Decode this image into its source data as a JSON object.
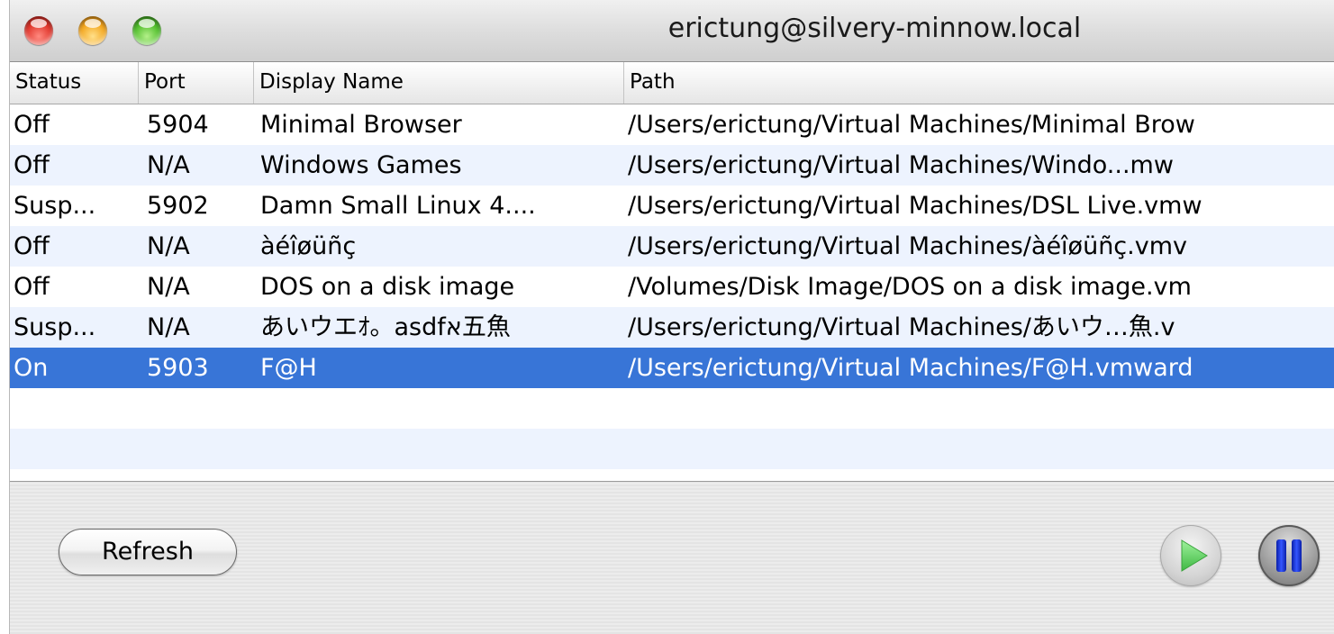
{
  "window": {
    "title": "erictung@silvery-minnow.local"
  },
  "table": {
    "columns": [
      "Status",
      "Port",
      "Display Name",
      "Path"
    ],
    "rows": [
      {
        "status": "Off",
        "port": "5904",
        "name": "Minimal Browser",
        "path": "/Users/erictung/Virtual Machines/Minimal Brow"
      },
      {
        "status": "Off",
        "port": "N/A",
        "name": "Windows Games",
        "path": "/Users/erictung/Virtual Machines/Windo...mw"
      },
      {
        "status": "Susp...",
        "port": "5902",
        "name": "Damn Small Linux 4....",
        "path": "/Users/erictung/Virtual Machines/DSL Live.vmw"
      },
      {
        "status": "Off",
        "port": "N/A",
        "name": "àéîøüñç",
        "path": "/Users/erictung/Virtual Machines/àéîøüñç.vmv"
      },
      {
        "status": "Off",
        "port": "N/A",
        "name": "DOS on a disk image",
        "path": "/Volumes/Disk Image/DOS on a disk image.vm"
      },
      {
        "status": "Susp...",
        "port": "N/A",
        "name": "あいウエｵ。asdfא五魚",
        "path": "/Users/erictung/Virtual Machines/あいウ…魚.v"
      },
      {
        "status": "On",
        "port": "5903",
        "name": "F@H",
        "path": "/Users/erictung/Virtual Machines/F@H.vmward"
      }
    ],
    "selected_row": 6
  },
  "controls": {
    "refresh_label": "Refresh",
    "play_icon": "play-icon",
    "pause_icon": "pause-icon"
  },
  "colors": {
    "selection": "#3875d7",
    "alt_row": "#edf3fe",
    "play_green": "#46c84a",
    "pause_blue": "#1f3fe0"
  }
}
